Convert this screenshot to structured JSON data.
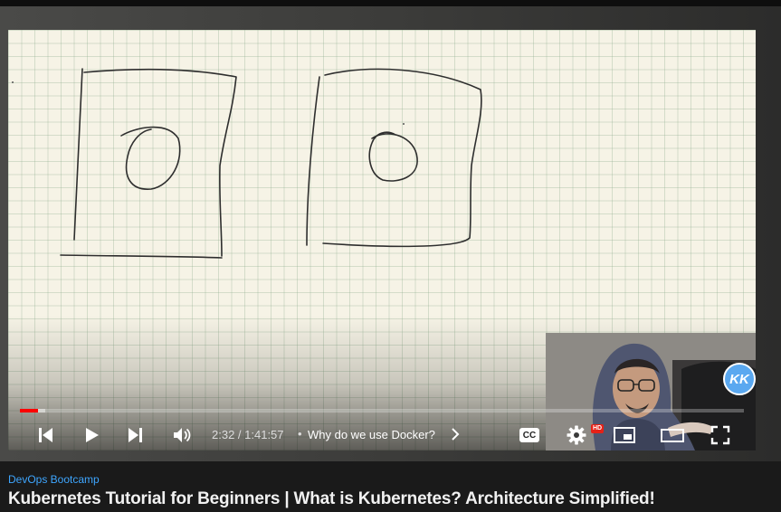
{
  "player": {
    "current_time": "2:32",
    "duration": "1:41:57",
    "time_display": "2:32 / 1:41:57",
    "chapter_separator": "•",
    "chapter_title": "Why do we use Docker?",
    "progress_fraction": 0.025,
    "buffered_fraction": 0.035,
    "hd_badge": "HD",
    "cc_label": "CC",
    "webcam_logo_text": "KK"
  },
  "controls": {
    "icons": [
      "previous-icon",
      "play-icon",
      "next-icon",
      "volume-icon",
      "chevron-right-icon",
      "captions-icon",
      "settings-icon",
      "miniplayer-icon",
      "theater-icon",
      "fullscreen-icon"
    ]
  },
  "video": {
    "channel": "DevOps Bootcamp",
    "title": "Kubernetes Tutorial for Beginners | What is Kubernetes? Architecture Simplified!"
  },
  "colors": {
    "progress_played": "#ff0000",
    "channel_link": "#3ea6ff",
    "hd_badge": "#e62117",
    "whiteboard": "#f6f3e6",
    "logo_badge": "#5aa8f0"
  }
}
